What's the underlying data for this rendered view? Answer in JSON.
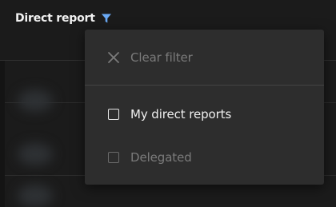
{
  "header": {
    "column_label": "Direct report",
    "filter_icon": "filter-icon",
    "filter_icon_color": "#6aa9f5"
  },
  "filter_menu": {
    "clear": {
      "label": "Clear filter",
      "icon": "close-icon",
      "enabled": false
    },
    "options": [
      {
        "label": "My direct reports",
        "checked": false,
        "enabled": true
      },
      {
        "label": "Delegated",
        "checked": false,
        "enabled": false
      }
    ]
  },
  "colors": {
    "background": "#1b1b1b",
    "menu_background": "#2d2d2d",
    "text_enabled": "#f0f0f0",
    "text_disabled": "#7b7b7b",
    "accent": "#6aa9f5"
  }
}
